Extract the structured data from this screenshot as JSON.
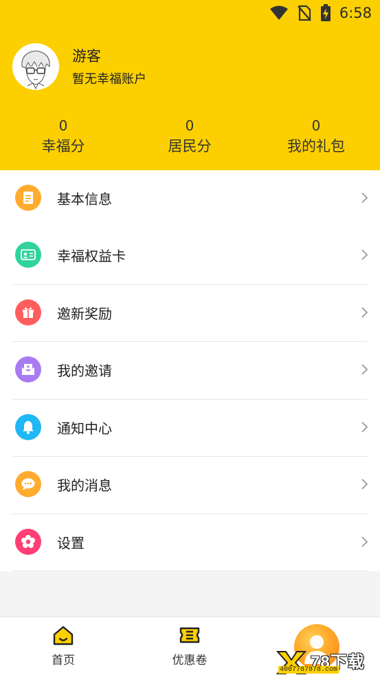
{
  "status_bar": {
    "time": "6:58"
  },
  "profile": {
    "name": "游客",
    "subtitle": "暂无幸福账户"
  },
  "stats": [
    {
      "value": "0",
      "label": "幸福分"
    },
    {
      "value": "0",
      "label": "居民分"
    },
    {
      "value": "0",
      "label": "我的礼包"
    }
  ],
  "menu": [
    {
      "label": "基本信息",
      "icon": "document-icon",
      "color": "#ffab2e"
    },
    {
      "label": "幸福权益卡",
      "icon": "id-card-icon",
      "color": "#2fd49a"
    },
    {
      "label": "邀新奖励",
      "icon": "gift-icon",
      "color": "#ff5e5e"
    },
    {
      "label": "我的邀请",
      "icon": "envelope-icon",
      "color": "#a97bf2"
    },
    {
      "label": "通知中心",
      "icon": "bell-icon",
      "color": "#1fb8f5"
    },
    {
      "label": "我的消息",
      "icon": "message-icon",
      "color": "#ffab2e"
    },
    {
      "label": "设置",
      "icon": "flower-settings-icon",
      "color": "#ff3f75"
    }
  ],
  "tabs": [
    {
      "label": "首页",
      "icon": "home-icon"
    },
    {
      "label": "优惠卷",
      "icon": "coupon-icon"
    }
  ],
  "colors": {
    "header": "#fcd000",
    "accent": "#ffa928"
  },
  "watermark": {
    "main": "78下载",
    "sub": "4007787878.com"
  }
}
